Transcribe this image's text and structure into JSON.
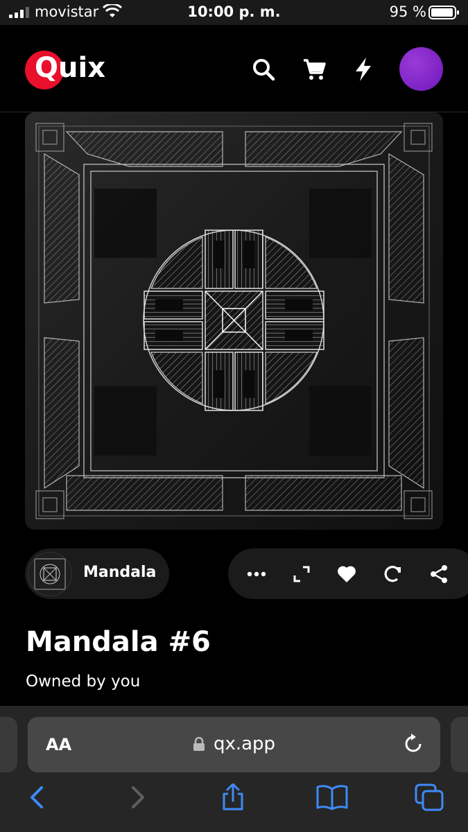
{
  "status_bar": {
    "carrier": "movistar",
    "time": "10:00 p. m.",
    "battery_percent": "95 %"
  },
  "header": {
    "logo_text": "Quix",
    "icons": [
      "search-icon",
      "cart-icon",
      "lightning-icon"
    ],
    "avatar_color": "#7c22c4"
  },
  "collection": {
    "name": "Mandala"
  },
  "actions": [
    "more-icon",
    "expand-icon",
    "heart-icon",
    "refresh-icon",
    "share-icon"
  ],
  "item": {
    "title": "Mandala #6",
    "owner": "Owned by you"
  },
  "browser": {
    "text_size_label": "AA",
    "url": "qx.app",
    "toolbar": [
      "back-icon",
      "forward-icon",
      "share-icon",
      "bookmarks-icon",
      "tabs-icon"
    ]
  },
  "colors": {
    "brand_red": "#e8102a",
    "safari_blue": "#3e8bf7"
  }
}
